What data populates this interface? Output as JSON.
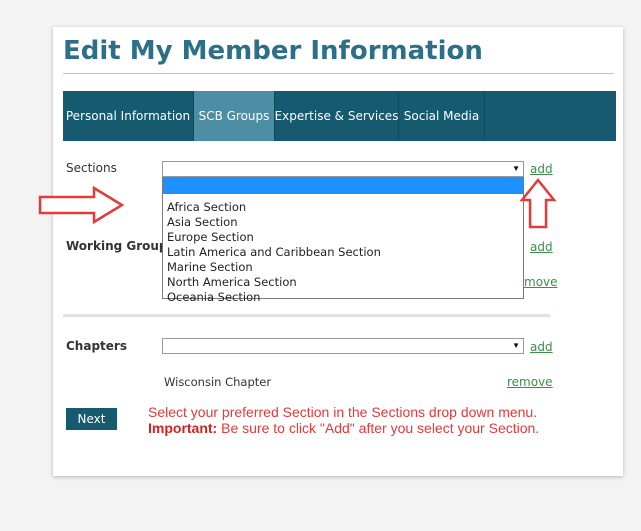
{
  "header": {
    "title": "Edit My Member Information"
  },
  "tabs": [
    {
      "label": "Personal Information"
    },
    {
      "label": "SCB Groups"
    },
    {
      "label": "Expertise & Services"
    },
    {
      "label": "Social Media"
    }
  ],
  "active_tab": "SCB Groups",
  "sections": {
    "label": "Sections",
    "selected": "",
    "add_label": "add",
    "options": [
      "Africa Section",
      "Asia Section",
      "Europe Section",
      "Latin America and Caribbean Section",
      "Marine Section",
      "North America Section",
      "Oceania Section"
    ]
  },
  "working_groups": {
    "label": "Working Groups",
    "add_label": "add",
    "remove_label": "move"
  },
  "chapters": {
    "label": "Chapters",
    "selected": "",
    "add_label": "add",
    "items": [
      {
        "name": "Wisconsin Chapter",
        "remove_label": "remove"
      }
    ]
  },
  "footer": {
    "next_label": "Next",
    "note_line1": "Select your preferred Section in the Sections drop down menu.",
    "note_important": "Important:",
    "note_line2": "Be sure to click \"Add\" after you select your Section."
  },
  "colors": {
    "brand": "#165a70",
    "active_tab": "#4e8ea4",
    "title": "#2d6f88",
    "link": "#3c8f46",
    "annotation": "#e33a3a",
    "highlight": "#1e90ff"
  },
  "icons": {
    "dropdown_arrow": "triangle-down",
    "annotation_right": "arrow-right-outline",
    "annotation_up": "arrow-up-outline"
  }
}
